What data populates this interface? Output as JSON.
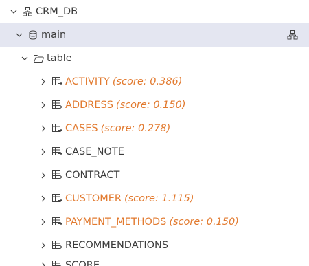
{
  "tree": {
    "database": {
      "label": "CRM_DB",
      "icon": "schema-icon"
    },
    "schema": {
      "label": "main",
      "icon": "database-icon",
      "action_icon": "schema-diagram-icon"
    },
    "folder": {
      "label": "table",
      "icon": "folder-icon"
    },
    "tables": [
      {
        "name": "ACTIVITY",
        "score": "(score: 0.386)"
      },
      {
        "name": "ADDRESS",
        "score": "(score: 0.150)"
      },
      {
        "name": "CASES",
        "score": "(score: 0.278)"
      },
      {
        "name": "CASE_NOTE",
        "score": ""
      },
      {
        "name": "CONTRACT",
        "score": ""
      },
      {
        "name": "CUSTOMER",
        "score": "(score: 1.115)"
      },
      {
        "name": "PAYMENT_METHODS",
        "score": "(score: 0.150)"
      },
      {
        "name": "RECOMMENDATIONS",
        "score": ""
      },
      {
        "name": "SCORE",
        "score": ""
      }
    ]
  },
  "colors": {
    "scored_text": "#e27a2f",
    "normal_text": "#3b3b3b",
    "selected_bg": "#e4e6f1"
  }
}
